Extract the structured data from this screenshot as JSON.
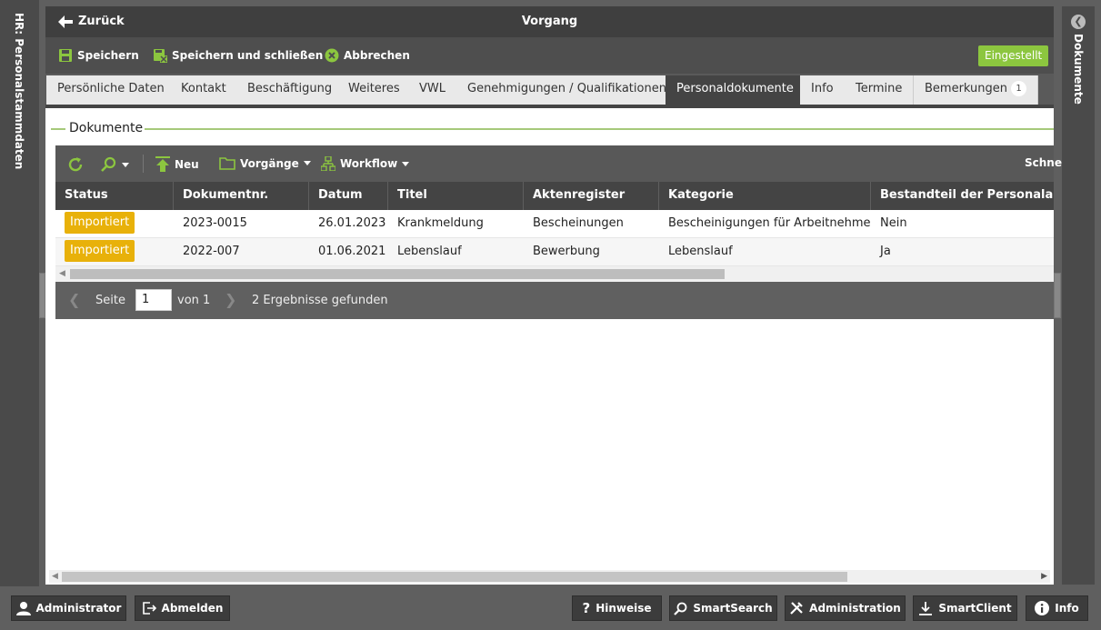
{
  "left_panel": {
    "label": "HR: Personalstammdaten"
  },
  "right_panel": {
    "label": "Dokumente"
  },
  "header": {
    "back_label": "Zurück",
    "title": "Vorgang"
  },
  "toolbar": {
    "save_label": "Speichern",
    "save_close_label": "Speichern und schließen",
    "cancel_label": "Abbrechen",
    "status": "Eingestellt"
  },
  "tabs": [
    {
      "label": "Persönliche Daten"
    },
    {
      "label": "Kontakt"
    },
    {
      "label": "Beschäftigung"
    },
    {
      "label": "Weiteres"
    },
    {
      "label": "VWL"
    },
    {
      "label": "Genehmigungen / Qualifikationen"
    },
    {
      "label": "Personaldokumente",
      "active": true
    },
    {
      "label": "Info"
    },
    {
      "label": "Termine"
    },
    {
      "label": "Bemerkungen",
      "badge": "1"
    }
  ],
  "section": {
    "title": "Dokumente"
  },
  "grid_toolbar": {
    "new_label": "Neu",
    "processes_label": "Vorgänge",
    "workflow_label": "Workflow",
    "quick_label": "Schne"
  },
  "table": {
    "columns": [
      "Status",
      "Dokumentnr.",
      "Datum",
      "Titel",
      "Aktenregister",
      "Kategorie",
      "Bestandteil der Personalakte"
    ],
    "rows": [
      [
        "Importiert",
        "2023-0015",
        "26.01.2023",
        "Krankmeldung",
        "Bescheinungen",
        "Bescheinigungen für Arbeitnehmer",
        "Nein"
      ],
      [
        "Importiert",
        "2022-007",
        "01.06.2021",
        "Lebenslauf",
        "Bewerbung",
        "Lebenslauf",
        "Ja"
      ]
    ]
  },
  "pager": {
    "page_label": "Seite",
    "page_value": "1",
    "of_label": "von 1",
    "result_text": "2 Ergebnisse gefunden"
  },
  "footer": {
    "user_label": "Administrator",
    "logout_label": "Abmelden",
    "hints_label": "Hinweise",
    "smartsearch_label": "SmartSearch",
    "admin_label": "Administration",
    "smartclient_label": "SmartClient",
    "info_label": "Info"
  },
  "colors": {
    "accent_green": "#8cc63f",
    "status_yellow": "#e8b10a",
    "dark_bar": "#3f3f3f"
  }
}
